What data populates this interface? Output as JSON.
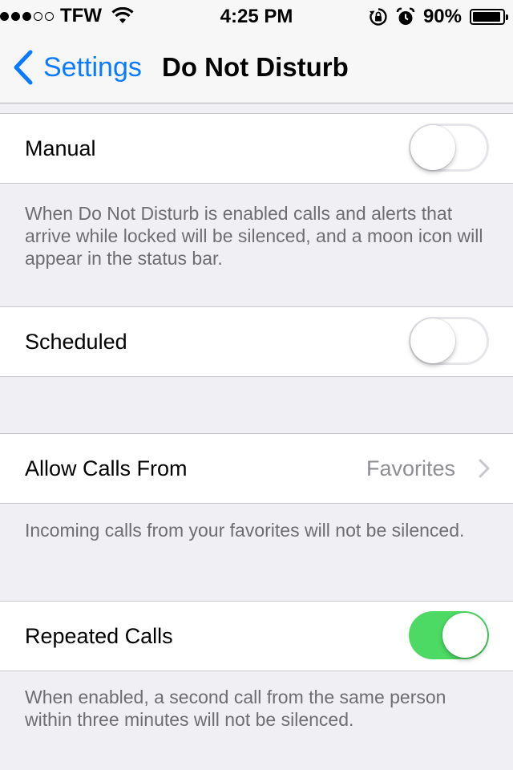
{
  "status_bar": {
    "carrier": "TFW",
    "time": "4:25 PM",
    "battery": "90%",
    "signal_bars_filled": 3,
    "signal_bars_total": 5,
    "icons": [
      "wifi-icon",
      "rotation-lock-icon",
      "alarm-icon",
      "battery-icon"
    ]
  },
  "nav": {
    "back_label": "Settings",
    "title": "Do Not Disturb"
  },
  "manual": {
    "label": "Manual",
    "enabled": false,
    "footer": "When Do Not Disturb is enabled calls and alerts that arrive while locked will be silenced, and a moon icon will appear in the status bar."
  },
  "scheduled": {
    "label": "Scheduled",
    "enabled": false
  },
  "allow_calls": {
    "label": "Allow Calls From",
    "value": "Favorites",
    "footer": "Incoming calls from your favorites will not be silenced."
  },
  "repeated_calls": {
    "label": "Repeated Calls",
    "enabled": true,
    "footer": "When enabled, a second call from the same person within three minutes will not be silenced."
  },
  "colors": {
    "accent": "#0a7bff",
    "toggle_on": "#4cd964",
    "background": "#efeff4",
    "footer_text": "#6d6d72"
  }
}
